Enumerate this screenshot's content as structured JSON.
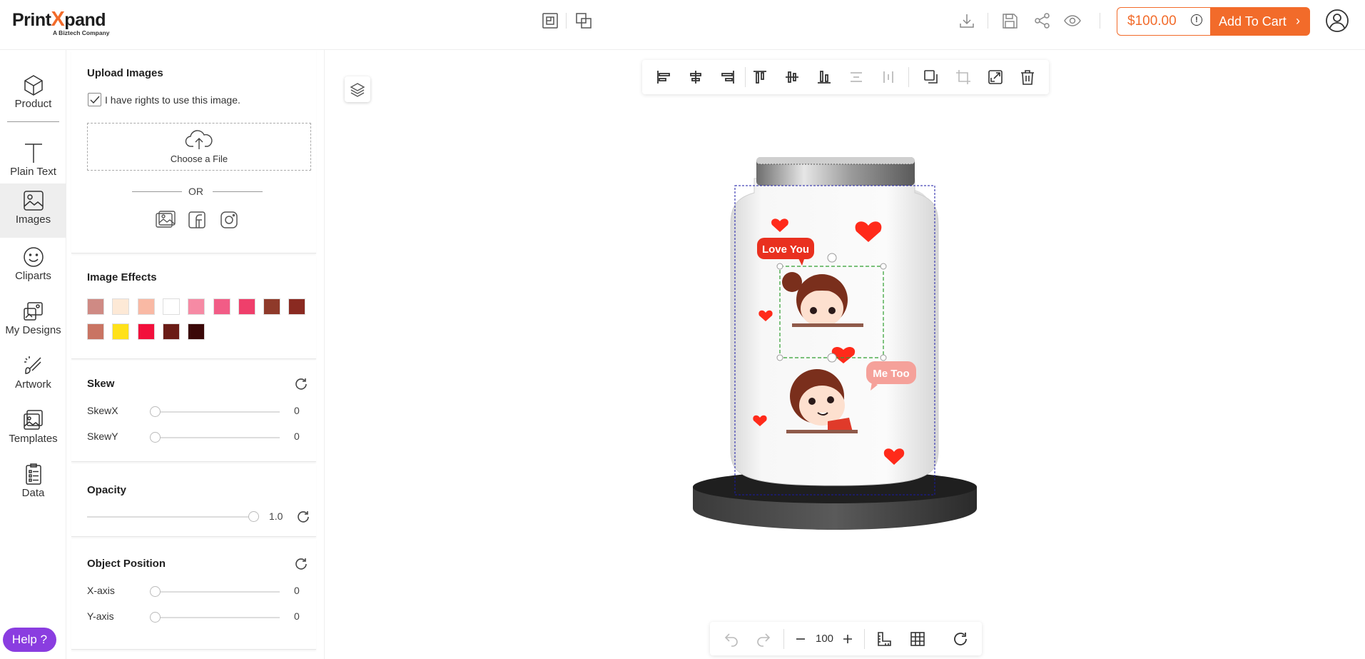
{
  "brand": {
    "name_part1": "Print",
    "name_x": "X",
    "name_part2": "pand",
    "tagline": "A Biztech Company"
  },
  "header": {
    "price": "$100.00",
    "price_info": "!",
    "add_to_cart": "Add To Cart",
    "accent": "#f26b2a"
  },
  "leftnav": {
    "items": [
      {
        "label": "Product",
        "icon": "cube-icon"
      },
      {
        "label": "Plain Text",
        "icon": "text-icon"
      },
      {
        "label": "Images",
        "icon": "image-icon"
      },
      {
        "label": "Cliparts",
        "icon": "smiley-icon"
      },
      {
        "label": "My Designs",
        "icon": "designs-icon"
      },
      {
        "label": "Artwork",
        "icon": "artwork-icon"
      },
      {
        "label": "Templates",
        "icon": "templates-icon"
      },
      {
        "label": "Data",
        "icon": "data-icon"
      }
    ],
    "active": "Images",
    "help": "Help ?"
  },
  "upload": {
    "title": "Upload Images",
    "rights_label": "I have rights to use this image.",
    "choose_file": "Choose a File",
    "or": "OR"
  },
  "effects": {
    "title": "Image Effects",
    "swatches": [
      "#cf8a84",
      "#fde9d6",
      "#f9b9a4",
      "#ffffff",
      "#f68aa4",
      "#f25c86",
      "#ef3f6b",
      "#8f3a2a",
      "#8a2a21",
      "#c97463",
      "#ffe11a",
      "#f2103c",
      "#6a1c16",
      "#3b0808"
    ]
  },
  "skew": {
    "title": "Skew",
    "x_label": "SkewX",
    "x_value": "0",
    "y_label": "SkewY",
    "y_value": "0"
  },
  "opacity": {
    "title": "Opacity",
    "value": "1.0"
  },
  "position": {
    "title": "Object Position",
    "x_label": "X-axis",
    "x_value": "0",
    "y_label": "Y-axis",
    "y_value": "0"
  },
  "canvas": {
    "zoom": "100",
    "artwork_text_1": "Love You",
    "artwork_text_2": "Me Too"
  }
}
